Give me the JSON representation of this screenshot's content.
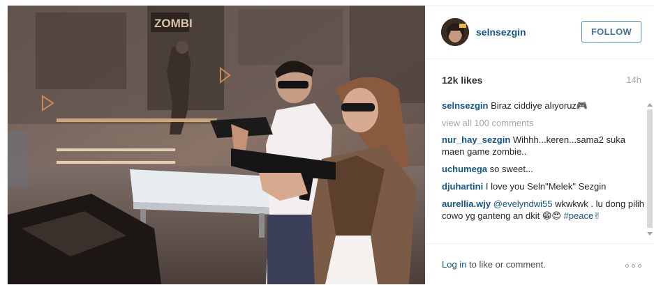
{
  "post": {
    "username": "selnsezgin",
    "follow_label": "FOLLOW",
    "likes": "12k likes",
    "time": "14h",
    "view_all": "view all 100 comments",
    "comments": [
      {
        "user": "selnsezgin",
        "parts": [
          {
            "text": "Biraz ciddiye alıyoruz🎮"
          }
        ]
      },
      {
        "user": "nur_hay_sezgin",
        "parts": [
          {
            "text": "Wihhh...keren...sama2 suka maen game zombie.."
          }
        ]
      },
      {
        "user": "uchumega",
        "parts": [
          {
            "text": "so sweet..."
          }
        ]
      },
      {
        "user": "djuhartini",
        "parts": [
          {
            "text": "I love you Seln\"Melek\" Sezgin"
          }
        ]
      },
      {
        "user": "aurellia.wjy",
        "parts": [
          {
            "text": "@evelyndwi55",
            "mention": true
          },
          {
            "text": " wkwkwk . lu dong pilih cowo yg ganteng an dkit 😁😍 "
          },
          {
            "text": "#peace✌",
            "mention": true
          }
        ]
      }
    ],
    "login_link": "Log in",
    "login_rest": " to like or comment.",
    "more_icon": "more-options-icon"
  },
  "photo": {
    "sign_text": "ZOMBI"
  }
}
